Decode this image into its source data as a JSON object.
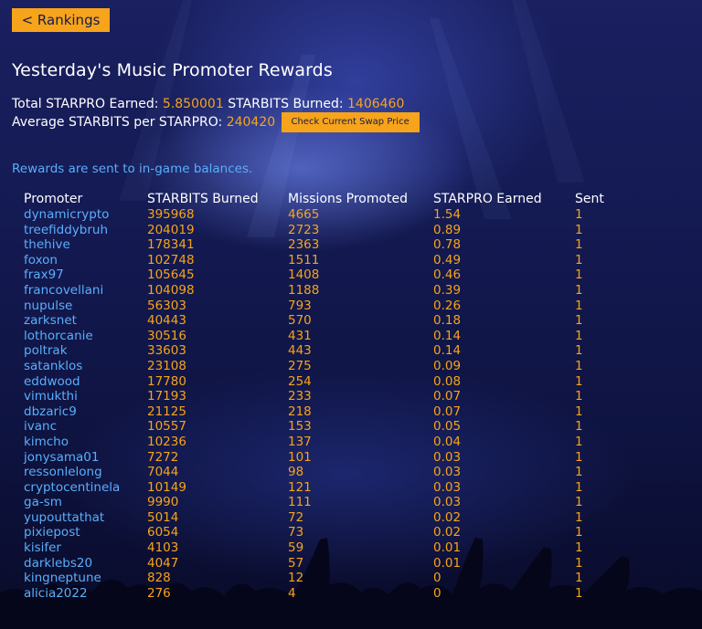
{
  "nav": {
    "back_label": "< Rankings"
  },
  "page": {
    "title": "Yesterday's Music Promoter Rewards"
  },
  "stats": {
    "total_label": "Total STARPRO Earned:",
    "total_value": "5.850001",
    "burned_label": "STARBITS Burned:",
    "burned_value": "1406460",
    "avg_label": "Average STARBITS per STARPRO:",
    "avg_value": "240420",
    "swap_button": "Check Current Swap Price"
  },
  "note": "Rewards are sent to in-game balances.",
  "table": {
    "headers": [
      "Promoter",
      "STARBITS Burned",
      "Missions Promoted",
      "STARPRO Earned",
      "Sent"
    ],
    "rows": [
      [
        "dynamicrypto",
        "395968",
        "4665",
        "1.54",
        "1"
      ],
      [
        "treefiddybruh",
        "204019",
        "2723",
        "0.89",
        "1"
      ],
      [
        "thehive",
        "178341",
        "2363",
        "0.78",
        "1"
      ],
      [
        "foxon",
        "102748",
        "1511",
        "0.49",
        "1"
      ],
      [
        "frax97",
        "105645",
        "1408",
        "0.46",
        "1"
      ],
      [
        "francovellani",
        "104098",
        "1188",
        "0.39",
        "1"
      ],
      [
        "nupulse",
        "56303",
        "793",
        "0.26",
        "1"
      ],
      [
        "zarksnet",
        "40443",
        "570",
        "0.18",
        "1"
      ],
      [
        "lothorcanie",
        "30516",
        "431",
        "0.14",
        "1"
      ],
      [
        "poltrak",
        "33603",
        "443",
        "0.14",
        "1"
      ],
      [
        "satanklos",
        "23108",
        "275",
        "0.09",
        "1"
      ],
      [
        "eddwood",
        "17780",
        "254",
        "0.08",
        "1"
      ],
      [
        "vimukthi",
        "17193",
        "233",
        "0.07",
        "1"
      ],
      [
        "dbzaric9",
        "21125",
        "218",
        "0.07",
        "1"
      ],
      [
        "ivanc",
        "10557",
        "153",
        "0.05",
        "1"
      ],
      [
        "kimcho",
        "10236",
        "137",
        "0.04",
        "1"
      ],
      [
        "jonysama01",
        "7272",
        "101",
        "0.03",
        "1"
      ],
      [
        "ressonlelong",
        "7044",
        "98",
        "0.03",
        "1"
      ],
      [
        "cryptocentinela",
        "10149",
        "121",
        "0.03",
        "1"
      ],
      [
        "ga-sm",
        "9990",
        "111",
        "0.03",
        "1"
      ],
      [
        "yupouttathat",
        "5014",
        "72",
        "0.02",
        "1"
      ],
      [
        "pixiepost",
        "6054",
        "73",
        "0.02",
        "1"
      ],
      [
        "kisifer",
        "4103",
        "59",
        "0.01",
        "1"
      ],
      [
        "darklebs20",
        "4047",
        "57",
        "0.01",
        "1"
      ],
      [
        "kingneptune",
        "828",
        "12",
        "0",
        "1"
      ],
      [
        "alicia2022",
        "276",
        "4",
        "0",
        "1"
      ]
    ]
  },
  "colors": {
    "accent": "#f7a41a",
    "link": "#5aaefc",
    "background": "#141a52"
  }
}
